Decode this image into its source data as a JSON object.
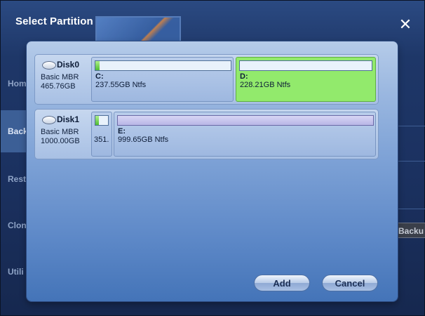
{
  "window": {
    "title": "Select Partition",
    "close_symbol": "✕"
  },
  "background": {
    "nav": [
      {
        "label": "Hom",
        "active": false
      },
      {
        "label": "Back",
        "active": true
      },
      {
        "label": "Rest",
        "active": false
      },
      {
        "label": "Clon",
        "active": false
      },
      {
        "label": "Utili",
        "active": false
      }
    ],
    "right_button": "Backu"
  },
  "disks": [
    {
      "name": "Disk0",
      "type": "Basic MBR",
      "size": "465.76GB",
      "partitions": [
        {
          "letter": "C:",
          "detail": "237.55GB Ntfs",
          "used_fraction": 0.03,
          "selected": false
        },
        {
          "letter": "D:",
          "detail": "228.21GB Ntfs",
          "used_fraction": 0.0,
          "selected": true
        }
      ]
    },
    {
      "name": "Disk1",
      "type": "Basic MBR",
      "size": "1000.00GB",
      "partitions": [
        {
          "letter": "",
          "detail": "351.",
          "used_fraction": 0.3,
          "selected": false
        },
        {
          "letter": "E:",
          "detail": "999.65GB Ntfs",
          "used_fraction": 0.0,
          "selected": false
        }
      ]
    }
  ],
  "buttons": {
    "add": "Add",
    "cancel": "Cancel"
  },
  "colors": {
    "selected_partition": "#92ea6c",
    "used_bar": "#4fbd33",
    "dialog_accent": "#5e89c8"
  }
}
